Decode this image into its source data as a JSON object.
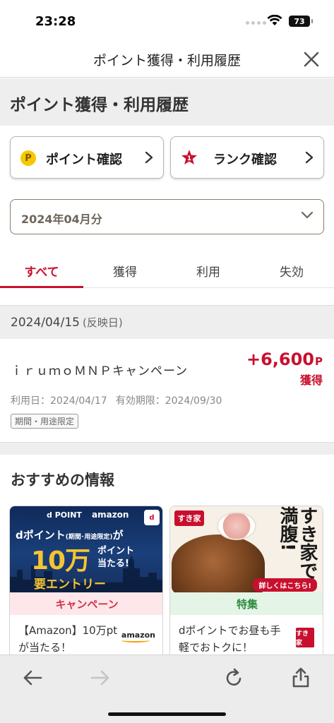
{
  "status_bar": {
    "time": "23:28",
    "battery": "73"
  },
  "nav": {
    "title": "ポイント獲得・利用履歴"
  },
  "page": {
    "heading": "ポイント獲得・利用履歴"
  },
  "buttons": {
    "point_confirm": "ポイント確認",
    "rank_confirm": "ランク確認",
    "point_icon_letter": "P"
  },
  "month_select": {
    "value": "2024年04月分"
  },
  "tabs": [
    {
      "label": "すべて",
      "active": true
    },
    {
      "label": "獲得",
      "active": false
    },
    {
      "label": "利用",
      "active": false
    },
    {
      "label": "失効",
      "active": false
    }
  ],
  "history": {
    "date": "2024/04/15",
    "date_note": "(反映日)",
    "items": [
      {
        "title": "ｉｒｕｍｏＭＮＰキャンペーン",
        "points": "+6,600",
        "unit": "P",
        "type": "獲得",
        "use_date": "利用日：2024/04/17",
        "expiry": "有効期限：2024/09/30",
        "tag": "期間・用途限定"
      }
    ]
  },
  "recommendations": {
    "heading": "おすすめの情報",
    "cards": [
      {
        "category": "キャンペーン",
        "text": "【Amazon】10万ptが当たる！",
        "banner": {
          "dpoint": "d POINT",
          "amazon": "amazon",
          "badge": "d",
          "line1": "dポイント",
          "line1_small": "(期間･用途限定)",
          "line1_end": "が",
          "big": "10万",
          "side1": "ポイント",
          "side2": "当たる!",
          "entry": "要エントリー"
        },
        "logo": "amazon"
      },
      {
        "category": "特集",
        "text": "dポイントでお昼も手軽でおトクに！",
        "banner": {
          "logo": "すき家",
          "copy": "すき家で満腹!",
          "more": "詳しくはこちら!"
        },
        "logo": "すき家"
      }
    ]
  },
  "colors": {
    "accent": "#c8102e",
    "point_yellow": "#f7c800"
  }
}
